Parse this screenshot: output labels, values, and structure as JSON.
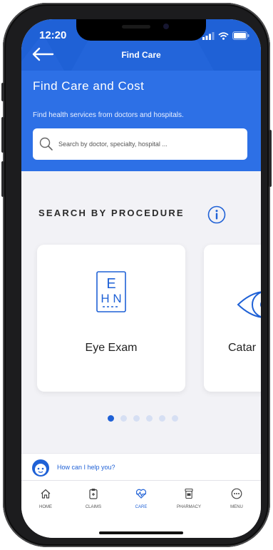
{
  "status_bar": {
    "time": "12:20"
  },
  "nav": {
    "title": "Find Care"
  },
  "hero": {
    "title": "Find Care and Cost",
    "subtitle": "Find health services from doctors and hospitals.",
    "search_placeholder": "Search by doctor, specialty, hospital ..."
  },
  "procedure": {
    "section_title": "SEARCH BY PROCEDURE",
    "cards": [
      {
        "label": "Eye Exam",
        "chart_letters": [
          "E",
          "H N"
        ],
        "icon": "eye-chart-icon"
      },
      {
        "label": "Catar",
        "icon": "eye-icon"
      }
    ],
    "pagination": {
      "total": 6,
      "active": 1
    }
  },
  "assistant": {
    "text": "How can I help you?"
  },
  "tabs": [
    {
      "label": "HOME",
      "icon": "home-icon"
    },
    {
      "label": "CLAIMS",
      "icon": "clipboard-icon"
    },
    {
      "label": "CARE",
      "icon": "heart-pulse-icon",
      "active": true
    },
    {
      "label": "PHARMACY",
      "icon": "pill-bottle-icon"
    },
    {
      "label": "MENU",
      "icon": "more-icon"
    }
  ],
  "colors": {
    "primary": "#1f61d6",
    "hero": "#2d70e6",
    "background": "#f2f2f6",
    "inactive_dot": "#d6dff3"
  }
}
